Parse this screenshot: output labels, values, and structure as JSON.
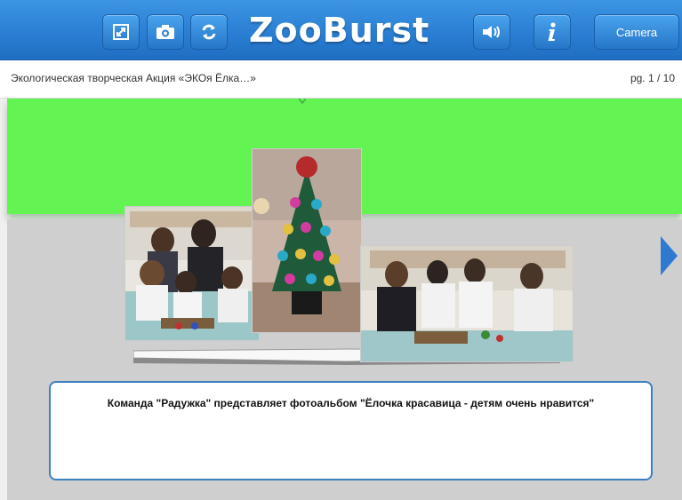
{
  "app": {
    "logo_text": "ZooBurst",
    "camera_label": "Camera",
    "brand_color": "#2a7fd4"
  },
  "toolbar_icons": [
    "fullscreen-icon",
    "photo-camera-icon",
    "refresh-icon",
    "sound-icon",
    "info-icon"
  ],
  "header": {
    "book_title": "Экологическая творческая Акция «ЭКОя Ёлка…»",
    "page_indicator": "pg. 1 / 10"
  },
  "caption": {
    "text": "Команда \"Радужка\" представляет фотоальбом \"Ёлочка красавица - детям очень нравится\""
  },
  "stage": {
    "background_color": "#63f353"
  }
}
